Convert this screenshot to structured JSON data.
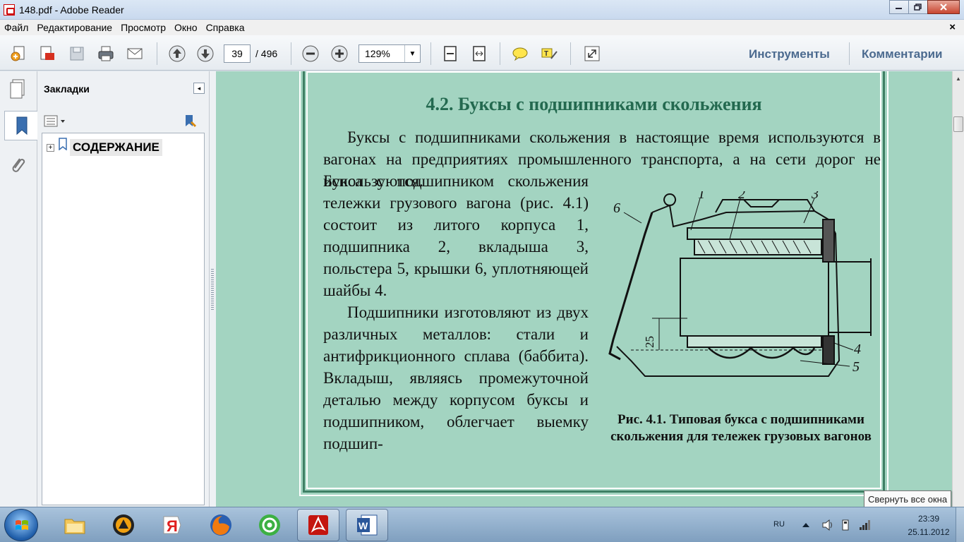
{
  "window": {
    "title": "148.pdf - Adobe Reader",
    "min_icon": "minimize-icon",
    "max_icon": "maximize-icon",
    "close_icon": "close-icon"
  },
  "menu": {
    "items": [
      "Файл",
      "Редактирование",
      "Просмотр",
      "Окно",
      "Справка"
    ],
    "close_doc": "×"
  },
  "toolbar": {
    "page_current": "39",
    "page_total": "/ 496",
    "zoom": "129%",
    "tools_label": "Инструменты",
    "comments_label": "Комментарии"
  },
  "bookmarks": {
    "title": "Закладки",
    "items": [
      {
        "label": "СОДЕРЖАНИЕ",
        "expander": "+"
      }
    ]
  },
  "document": {
    "section_title": "4.2. Буксы с подшипниками скольжения",
    "para1": "Буксы с подшипниками скольжения в настоящие время используются в вагонах на предприятиях промышленного транспорта, а на сети дорог не используются.",
    "para2": "Букса с подшипником скольжения тележки грузового вагона (рис. 4.1) состоит из литого корпуса 1, подшипника 2, вкладыша 3, польстера 5, крышки 6, уплотняющей шайбы 4.",
    "para3": "Подшипники изготовляют из двух различных металлов: стали и антифрикционного сплава (баббита). Вкладыш, являясь промежуточной деталью между корпусом буксы и подшипником, облегчает выемку подшип-",
    "figure_labels": {
      "l1": "1",
      "l2": "2",
      "l3": "3",
      "l4": "4",
      "l5": "5",
      "l6": "6",
      "dim": "25"
    },
    "caption": "Рис. 4.1. Типовая букса с подшипниками скольжения для тележек грузовых вагонов"
  },
  "taskbar": {
    "lang": "RU",
    "time": "23:39",
    "date": "25.11.2012",
    "tooltip": "Свернуть все окна"
  },
  "colors": {
    "page_bg": "#a3d4c1",
    "page_border": "#3e7f64",
    "title_color": "#23694f",
    "link_color": "#4b6a8f"
  }
}
